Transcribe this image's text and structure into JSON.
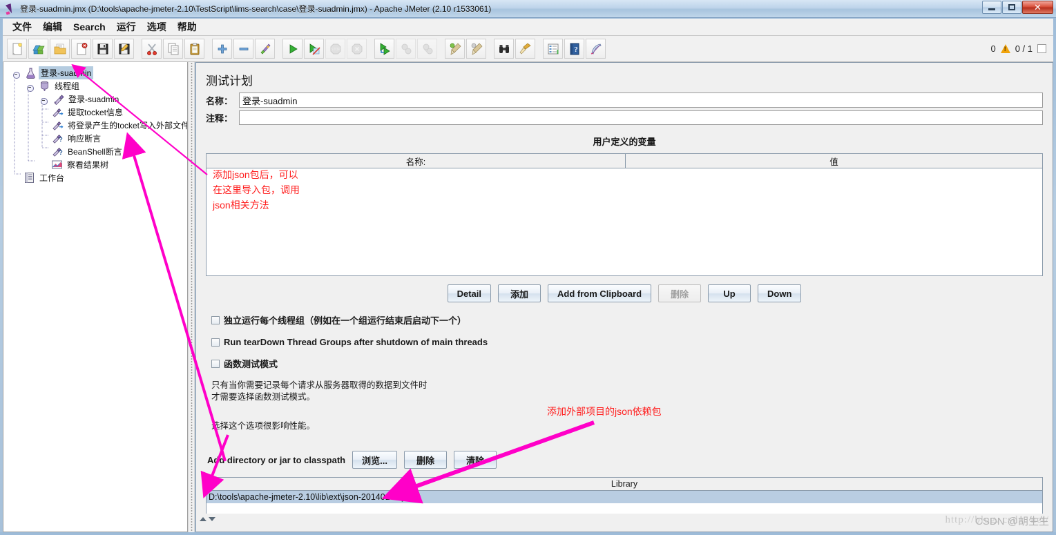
{
  "window": {
    "title": "登录-suadmin.jmx (D:\\tools\\apache-jmeter-2.10\\TestScript\\lims-search\\case\\登录-suadmin.jmx) - Apache JMeter (2.10 r1533061)",
    "icon": "jmeter-feather-icon",
    "minimize_label": "Minimize",
    "maximize_label": "Maximize",
    "close_label": "✕"
  },
  "menubar": {
    "items": [
      {
        "label": "文件",
        "name": "menu-file"
      },
      {
        "label": "编辑",
        "name": "menu-edit"
      },
      {
        "label": "Search",
        "name": "menu-search"
      },
      {
        "label": "运行",
        "name": "menu-run"
      },
      {
        "label": "选项",
        "name": "menu-options"
      },
      {
        "label": "帮助",
        "name": "menu-help"
      }
    ]
  },
  "toolbar": {
    "buttons": [
      {
        "icon": "new-document-icon",
        "enabled": true
      },
      {
        "icon": "templates-icon",
        "enabled": true
      },
      {
        "icon": "open-folder-icon",
        "enabled": true
      },
      {
        "icon": "close-document-icon",
        "enabled": true
      },
      {
        "icon": "save-icon",
        "enabled": true
      },
      {
        "icon": "save-as-icon",
        "enabled": true
      },
      {
        "icon": "cut-scissors-icon",
        "enabled": true
      },
      {
        "icon": "copy-icon",
        "enabled": true
      },
      {
        "icon": "paste-clipboard-icon",
        "enabled": true
      },
      {
        "icon": "expand-all-plus-icon",
        "enabled": true
      },
      {
        "icon": "collapse-all-minus-icon",
        "enabled": true
      },
      {
        "icon": "toggle-icon",
        "enabled": true
      },
      {
        "icon": "start-play-icon",
        "enabled": true
      },
      {
        "icon": "start-no-timers-icon",
        "enabled": true
      },
      {
        "icon": "stop-icon",
        "enabled": false
      },
      {
        "icon": "shutdown-icon",
        "enabled": false
      },
      {
        "icon": "start-remote-icon",
        "enabled": true
      },
      {
        "icon": "stop-remote-icon",
        "enabled": false
      },
      {
        "icon": "shutdown-remote-icon",
        "enabled": false
      },
      {
        "icon": "clear-broom-icon",
        "enabled": true
      },
      {
        "icon": "clear-all-broom-icon",
        "enabled": true
      },
      {
        "icon": "search-binoculars-icon",
        "enabled": true
      },
      {
        "icon": "reset-search-broom-icon",
        "enabled": true
      },
      {
        "icon": "function-helper-icon",
        "enabled": true
      },
      {
        "icon": "help-question-icon",
        "enabled": true
      },
      {
        "icon": "feather-icon",
        "enabled": true
      }
    ],
    "warning_count": "0",
    "warning_icon": "warning-triangle-icon",
    "thread_counter": "0 / 1"
  },
  "tree": {
    "nodes": [
      {
        "label": "登录-suadmin",
        "icon": "test-plan-icon",
        "depth": 0,
        "selected": true,
        "expandable": true,
        "name": "tree-node-test-plan"
      },
      {
        "label": "线程组",
        "icon": "thread-group-icon",
        "depth": 1,
        "selected": false,
        "expandable": true,
        "name": "tree-node-thread-group"
      },
      {
        "label": "登录-suadmin",
        "icon": "http-sampler-icon",
        "depth": 2,
        "selected": false,
        "expandable": true,
        "name": "tree-node-sampler"
      },
      {
        "label": "提取tocket信息",
        "icon": "post-processor-icon",
        "depth": 3,
        "selected": false,
        "expandable": false,
        "name": "tree-node-extractor"
      },
      {
        "label": "将登录产生的tocket写入外部文件",
        "icon": "post-processor-icon",
        "depth": 3,
        "selected": false,
        "expandable": false,
        "name": "tree-node-write-file"
      },
      {
        "label": "响应断言",
        "icon": "assertion-icon",
        "depth": 3,
        "selected": false,
        "expandable": false,
        "name": "tree-node-response-assertion"
      },
      {
        "label": "BeanShell断言",
        "icon": "assertion-icon",
        "depth": 3,
        "selected": false,
        "expandable": false,
        "name": "tree-node-beanshell-assertion"
      },
      {
        "label": "察看结果树",
        "icon": "view-results-tree-icon",
        "depth": 2,
        "selected": false,
        "expandable": false,
        "name": "tree-node-view-results"
      },
      {
        "label": "工作台",
        "icon": "workbench-icon",
        "depth": 0,
        "selected": false,
        "expandable": false,
        "name": "tree-node-workbench"
      }
    ]
  },
  "main": {
    "panel_title": "测试计划",
    "name_label": "名称：",
    "name_value": "登录-suadmin",
    "comment_label": "注释：",
    "comment_value": "",
    "udv_title": "用户定义的变量",
    "udv_columns": [
      "名称:",
      "值"
    ],
    "udv_rows": [],
    "buttons": [
      {
        "label": "Detail",
        "enabled": true,
        "name": "detail-button"
      },
      {
        "label": "添加",
        "enabled": true,
        "name": "add-button"
      },
      {
        "label": "Add from Clipboard",
        "enabled": true,
        "name": "add-from-clipboard-button"
      },
      {
        "label": "删除",
        "enabled": false,
        "name": "delete-button"
      },
      {
        "label": "Up",
        "enabled": true,
        "name": "up-button"
      },
      {
        "label": "Down",
        "enabled": true,
        "name": "down-button"
      }
    ],
    "checkboxes": [
      {
        "label": "独立运行每个线程组（例如在一个组运行结束后启动下一个）",
        "checked": false,
        "name": "checkbox-serialize-thread-groups"
      },
      {
        "label": "Run tearDown Thread Groups after shutdown of main threads",
        "checked": false,
        "name": "checkbox-teardown-on-shutdown"
      },
      {
        "label": "函数测试模式",
        "checked": false,
        "name": "checkbox-functional-test-mode"
      }
    ],
    "help_text_line1": "只有当你需要记录每个请求从服务器取得的数据到文件时",
    "help_text_line2": "才需要选择函数测试模式。",
    "help_text_line3": "选择这个选项很影响性能。",
    "classpath_label": "Add directory or jar to classpath",
    "classpath_buttons": [
      {
        "label": "浏览...",
        "name": "browse-button"
      },
      {
        "label": "删除",
        "name": "remove-button"
      },
      {
        "label": "清除",
        "name": "clear-button"
      }
    ],
    "library_header": "Library",
    "library_rows": [
      {
        "path": "D:\\tools\\apache-jmeter-2.10\\lib\\ext\\json-20140107.jar",
        "selected": true
      }
    ]
  },
  "annotations": [
    {
      "text": "添加json包后，可以\n在这里导入包，调用\njson相关方法",
      "name": "annotation-json-package-note",
      "color": "#ff1f1f"
    },
    {
      "text": "添加外部项目的json依赖包",
      "name": "annotation-external-jar-note",
      "color": "#ff1f1f"
    }
  ],
  "watermark": {
    "url_text": "http://blog. csdn. net/",
    "csdn_text": "CSDN @胡生生"
  },
  "colors": {
    "accent_arrow": "#ff00c8",
    "annotation_red": "#ff1f1f",
    "selection_blue": "#b5cce0",
    "panel_bg": "#f0f0f0",
    "titlebar_blue": "#bed4ea"
  }
}
